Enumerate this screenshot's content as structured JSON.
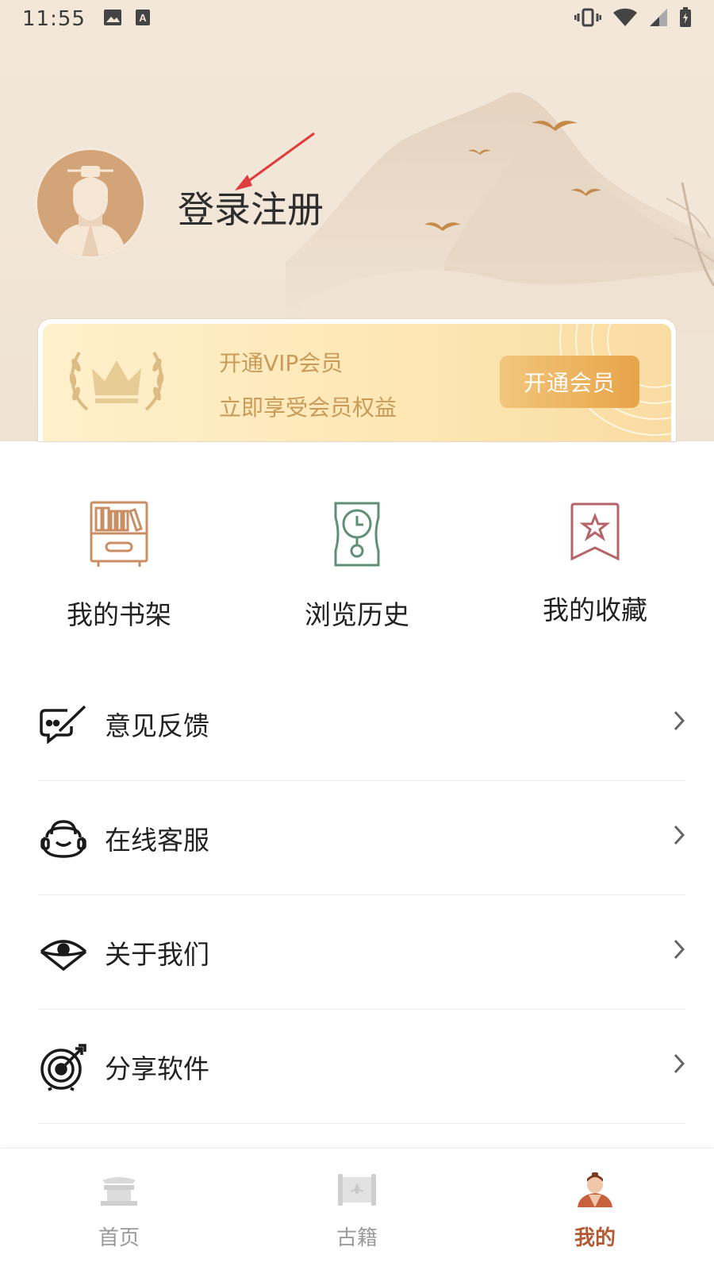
{
  "status_bar": {
    "time": "11:55",
    "left_icons": [
      "image-icon",
      "font-a-icon"
    ],
    "right_icons": [
      "vibrate-icon",
      "wifi-icon",
      "signal-icon",
      "battery-icon"
    ]
  },
  "profile": {
    "login_label": "登录注册",
    "avatar_icon": "sage-avatar-icon"
  },
  "vip": {
    "title": "开通VIP会员",
    "subtitle": "立即享受会员权益",
    "button_label": "开通会员",
    "crown_icon": "laurel-crown-icon"
  },
  "quick_actions": [
    {
      "label": "我的书架",
      "icon": "bookshelf-icon",
      "color": "#c98e63"
    },
    {
      "label": "浏览历史",
      "icon": "history-clock-icon",
      "color": "#5f8f75"
    },
    {
      "label": "我的收藏",
      "icon": "star-bookmark-icon",
      "color": "#b5646a"
    }
  ],
  "menu": [
    {
      "label": "意见反馈",
      "icon": "feedback-icon"
    },
    {
      "label": "在线客服",
      "icon": "customer-service-icon"
    },
    {
      "label": "关于我们",
      "icon": "fan-eye-icon"
    },
    {
      "label": "分享软件",
      "icon": "target-arrow-icon"
    }
  ],
  "bottom_nav": [
    {
      "label": "首页",
      "icon": "home-pavilion-icon",
      "active": false
    },
    {
      "label": "古籍",
      "icon": "scroll-icon",
      "active": false
    },
    {
      "label": "我的",
      "icon": "profile-person-icon",
      "active": true
    }
  ],
  "colors": {
    "accent": "#b35a35",
    "vip_text": "#c99b58",
    "vip_button": "#e8a448"
  }
}
